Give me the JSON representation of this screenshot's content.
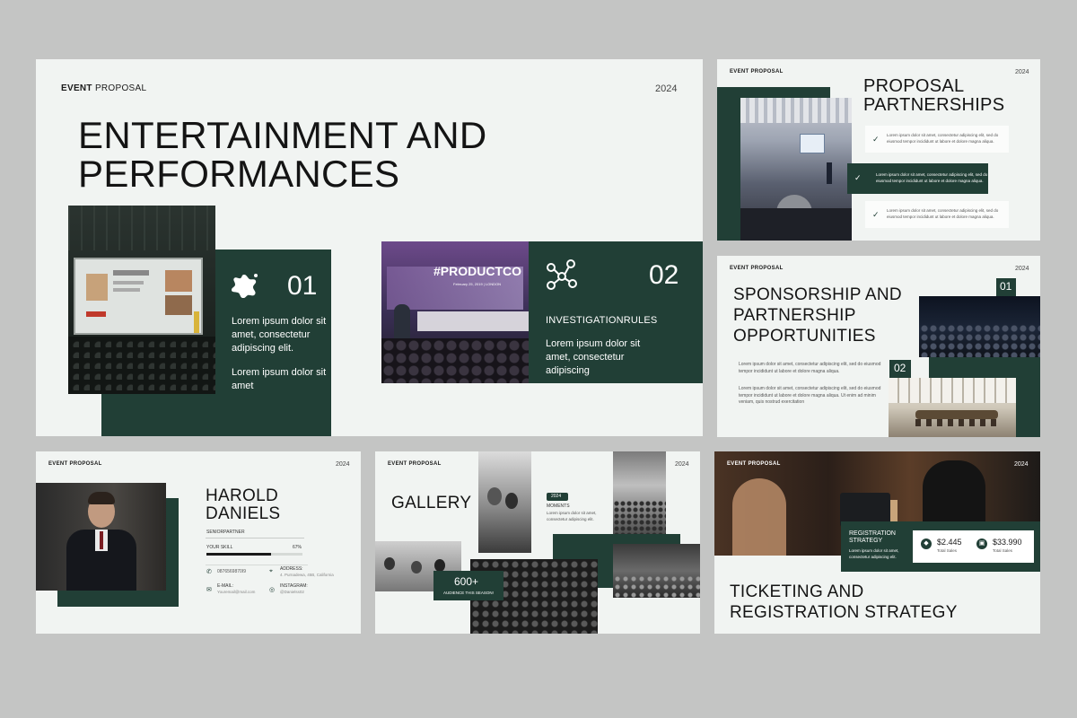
{
  "colors": {
    "background": "#c4c5c4",
    "slide": "#f1f4f2",
    "accent_green": "#213f36"
  },
  "slide1": {
    "brand_bold": "EVENT",
    "brand_rest": "PROPOSAL",
    "year": "2024",
    "title_line1": "ENTERTAINMENT AND",
    "title_line2": "PERFORMANCES",
    "card1": {
      "num": "01",
      "icon": "splash-icon",
      "text1": "Lorem ipsum dolor sit amet, consectetur adipiscing elit.",
      "text2": "Lorem ipsum dolor sit amet"
    },
    "card2": {
      "num": "02",
      "icon": "network-icon",
      "heading": "INVESTIGATIONRULES",
      "text": "Lorem ipsum dolor sit amet, consectetur adipiscing",
      "screen_title": "#PRODUCTCO",
      "screen_date": "February 25, 2019 | LONDON"
    }
  },
  "slide2": {
    "brand": "EVENT PROPOSAL",
    "year": "2024",
    "title_line1": "PROPOSAL",
    "title_line2": "PARTNERSHIPS",
    "items": [
      {
        "line1": "Lorem ipsum dolor sit amet, consectetur adipiscing elit, sed do",
        "line2": "eiusmod tempor incididunt ut labore et dolore magna aliqua."
      },
      {
        "line1": "Lorem ipsum dolor sit amet, consectetur adipiscing elit, sed do",
        "line2": "eiusmod tempor incididunt ut labore et dolore magna aliqua."
      },
      {
        "line1": "Lorem ipsum dolor sit amet, consectetur adipiscing elit, sed do",
        "line2": "eiusmod tempor incididunt ut labore et dolore magna aliqua."
      }
    ]
  },
  "slide3": {
    "brand": "EVENT PROPOSAL",
    "year": "2024",
    "title_line1": "SPONSORSHIP AND",
    "title_line2": "PARTNERSHIP",
    "title_line3": "OPPORTUNITIES",
    "num1": "01",
    "num2": "02",
    "para1": "Lorem ipsum dolor sit amet, consectetur adipiscing elit, sed do eiusmod tempor incididunt ut labore et dolore magna aliqua.",
    "para2": "Lorem ipsum dolor sit amet, consectetur adipiscing elit, sed do eiusmod tempor incididunt ut labore et dolore magna aliqua. Ut enim ad minim veniam, quis nostrud exercitation"
  },
  "slide4": {
    "brand": "EVENT PROPOSAL",
    "year": "2024",
    "name_line1": "HAROLD",
    "name_line2": "DANIELS",
    "role": "SENIORPARTNER",
    "skill_label": "YOUR SKILL",
    "skill_percent": "67%",
    "skill_value": 0.67,
    "phone": "0876569870I9",
    "address_label": "ADDRESS:",
    "address": "4. Purnadewa, 45B, California",
    "email_label": "E-MAIL:",
    "email": "Youremail@mail.com",
    "instagram_label": "INSTAGRAM:",
    "instagram": "@Danielss02"
  },
  "slide5": {
    "brand": "EVENT PROPOSAL",
    "year": "2024",
    "title": "GALLERY",
    "badge_year": "2024",
    "moments_label": "MOMENTS",
    "moments_text": "Lorem ipsum dolor sit amet, consectetur adipiscing elit.",
    "stat_value": "600+",
    "stat_label": "AUDIENCE THIS SEASON!"
  },
  "slide6": {
    "brand": "EVENT PROPOSAL",
    "year": "2024",
    "panel_title_line1": "REGISTRATION",
    "panel_title_line2": "STRATEGY",
    "panel_text": "Lorem ipsum dolor sit amet, consectetur adipiscing elit.",
    "stat1_value": "$2.445",
    "stat1_label": "Total Sales",
    "stat2_value": "$33.990",
    "stat2_label": "Total Sales",
    "title_line1": "TICKETING AND",
    "title_line2": "REGISTRATION STRATEGY"
  }
}
